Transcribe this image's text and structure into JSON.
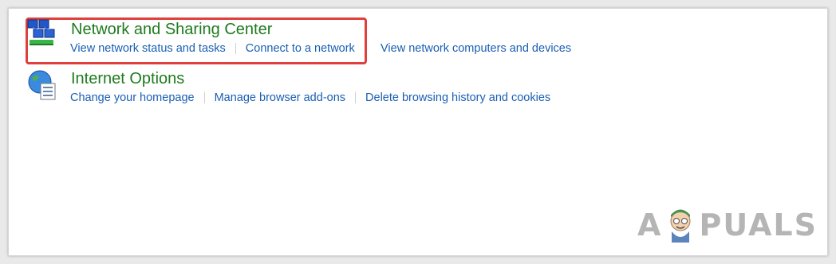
{
  "categories": [
    {
      "title": "Network and Sharing Center",
      "icon": "network-sharing-center-icon",
      "links": [
        "View network status and tasks",
        "Connect to a network"
      ]
    },
    {
      "title": "Internet Options",
      "icon": "internet-options-icon",
      "links": [
        "Change your homepage",
        "Manage browser add-ons",
        "Delete browsing history and cookies"
      ]
    }
  ],
  "extra_link": "View network computers and devices",
  "watermark": {
    "left": "A",
    "right": "PUALS"
  },
  "colors": {
    "title": "#1e7b1e",
    "link": "#1a5fb4",
    "highlight": "#e0403c"
  }
}
